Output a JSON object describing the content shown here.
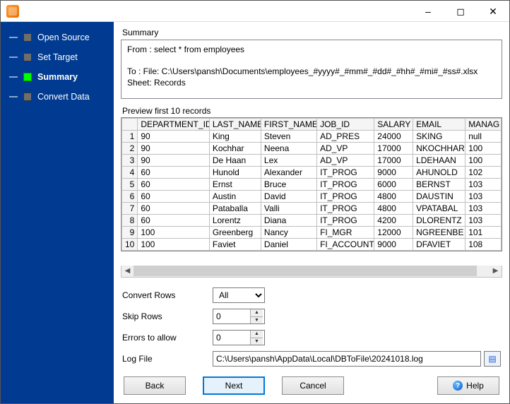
{
  "window": {
    "title": ""
  },
  "sidebar": {
    "items": [
      {
        "label": "Open Source",
        "active": false
      },
      {
        "label": "Set Target",
        "active": false
      },
      {
        "label": "Summary",
        "active": true
      },
      {
        "label": "Convert Data",
        "active": false
      }
    ]
  },
  "summary": {
    "heading": "Summary",
    "text": "From : select * from employees\n\nTo : File: C:\\Users\\pansh\\Documents\\employees_#yyyy#_#mm#_#dd#_#hh#_#mi#_#ss#.xlsx Sheet: Records"
  },
  "preview": {
    "label": "Preview first 10 records",
    "columns": [
      "DEPARTMENT_ID",
      "LAST_NAME",
      "FIRST_NAME",
      "JOB_ID",
      "SALARY",
      "EMAIL",
      "MANAG"
    ],
    "rows": [
      [
        "90",
        "King",
        "Steven",
        "AD_PRES",
        "24000",
        "SKING",
        "null"
      ],
      [
        "90",
        "Kochhar",
        "Neena",
        "AD_VP",
        "17000",
        "NKOCHHAR",
        "100"
      ],
      [
        "90",
        "De Haan",
        "Lex",
        "AD_VP",
        "17000",
        "LDEHAAN",
        "100"
      ],
      [
        "60",
        "Hunold",
        "Alexander",
        "IT_PROG",
        "9000",
        "AHUNOLD",
        "102"
      ],
      [
        "60",
        "Ernst",
        "Bruce",
        "IT_PROG",
        "6000",
        "BERNST",
        "103"
      ],
      [
        "60",
        "Austin",
        "David",
        "IT_PROG",
        "4800",
        "DAUSTIN",
        "103"
      ],
      [
        "60",
        "Pataballa",
        "Valli",
        "IT_PROG",
        "4800",
        "VPATABAL",
        "103"
      ],
      [
        "60",
        "Lorentz",
        "Diana",
        "IT_PROG",
        "4200",
        "DLORENTZ",
        "103"
      ],
      [
        "100",
        "Greenberg",
        "Nancy",
        "FI_MGR",
        "12000",
        "NGREENBE",
        "101"
      ],
      [
        "100",
        "Faviet",
        "Daniel",
        "FI_ACCOUNT",
        "9000",
        "DFAVIET",
        "108"
      ]
    ]
  },
  "options": {
    "convert_rows": {
      "label": "Convert Rows",
      "value": "All"
    },
    "skip_rows": {
      "label": "Skip Rows",
      "value": "0"
    },
    "errors": {
      "label": "Errors to allow",
      "value": "0"
    },
    "log_file": {
      "label": "Log File",
      "value": "C:\\Users\\pansh\\AppData\\Local\\DBToFile\\20241018.log"
    }
  },
  "footer": {
    "back": "Back",
    "next": "Next",
    "cancel": "Cancel",
    "help": "Help"
  }
}
